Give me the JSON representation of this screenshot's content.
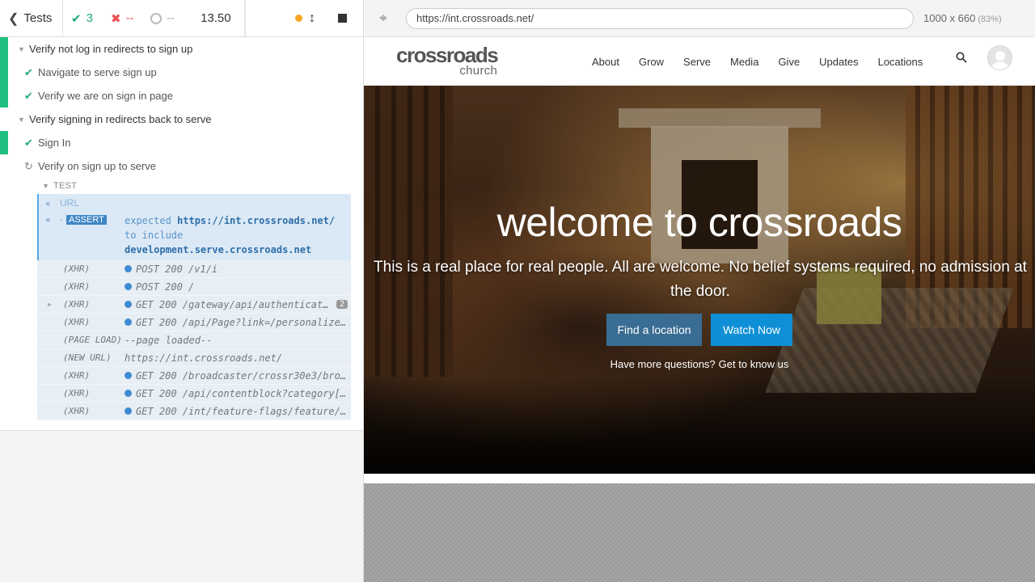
{
  "runner": {
    "header": {
      "tests_label": "Tests",
      "passed": "3",
      "failed": "--",
      "pending": "--",
      "duration": "13.50"
    },
    "suites": [
      {
        "title": "Verify not log in redirects to sign up",
        "tests": [
          {
            "label": "Navigate to serve sign up",
            "state": "passed"
          },
          {
            "label": "Verify we are on sign in page",
            "state": "passed"
          }
        ]
      },
      {
        "title": "Verify signing in redirects back to serve",
        "tests": [
          {
            "label": "Sign In",
            "state": "passed"
          },
          {
            "label": "Verify on sign up to serve",
            "state": "running"
          }
        ]
      }
    ],
    "section_label": "TEST",
    "commands": {
      "url_name": "URL",
      "assert_name": "ASSERT",
      "assert_dash": "-",
      "assert_expected": "expected",
      "assert_url": "https://int.crossroads.net/",
      "assert_include": "to include",
      "assert_target": "development.serve.crossroads.net",
      "log": [
        {
          "type": "(XHR)",
          "msg": "POST 200 /v1/i"
        },
        {
          "type": "(XHR)",
          "msg": "POST 200 /"
        },
        {
          "type": "(XHR)",
          "msg": "GET 200 /gateway/api/authenticat…",
          "count": "2"
        },
        {
          "type": "(XHR)",
          "msg": "GET 200 /api/Page?link=/personalize…"
        },
        {
          "type": "(PAGE LOAD)",
          "msg": "--page loaded--"
        },
        {
          "type": "(NEW URL)",
          "msg": "https://int.crossroads.net/"
        },
        {
          "type": "(XHR)",
          "msg": "GET 200 /broadcaster/crossr30e3/bro…"
        },
        {
          "type": "(XHR)",
          "msg": "GET 200 /api/contentblock?category[…"
        },
        {
          "type": "(XHR)",
          "msg": "GET 200 /int/feature-flags/feature/…"
        }
      ]
    }
  },
  "preview": {
    "url": "https://int.crossroads.net/",
    "viewport": "1000 x 660",
    "zoom": "(83%)"
  },
  "site": {
    "brand": "crossroads",
    "brand_sub": "church",
    "nav": [
      "About",
      "Grow",
      "Serve",
      "Media",
      "Give",
      "Updates",
      "Locations"
    ],
    "hero_title": "welcome to crossroads",
    "hero_sub": "This is a real place for real people. All are welcome. No belief systems required, no admission at the door.",
    "btn_find": "Find a location",
    "btn_watch": "Watch Now",
    "more_prefix": "Have more questions?",
    "more_link": "Get to know us"
  },
  "colors": {
    "pass": "#1fa97b",
    "fail": "#e94f4f",
    "find_btn": "#3a6d93",
    "watch_btn": "#0f8fd6"
  }
}
